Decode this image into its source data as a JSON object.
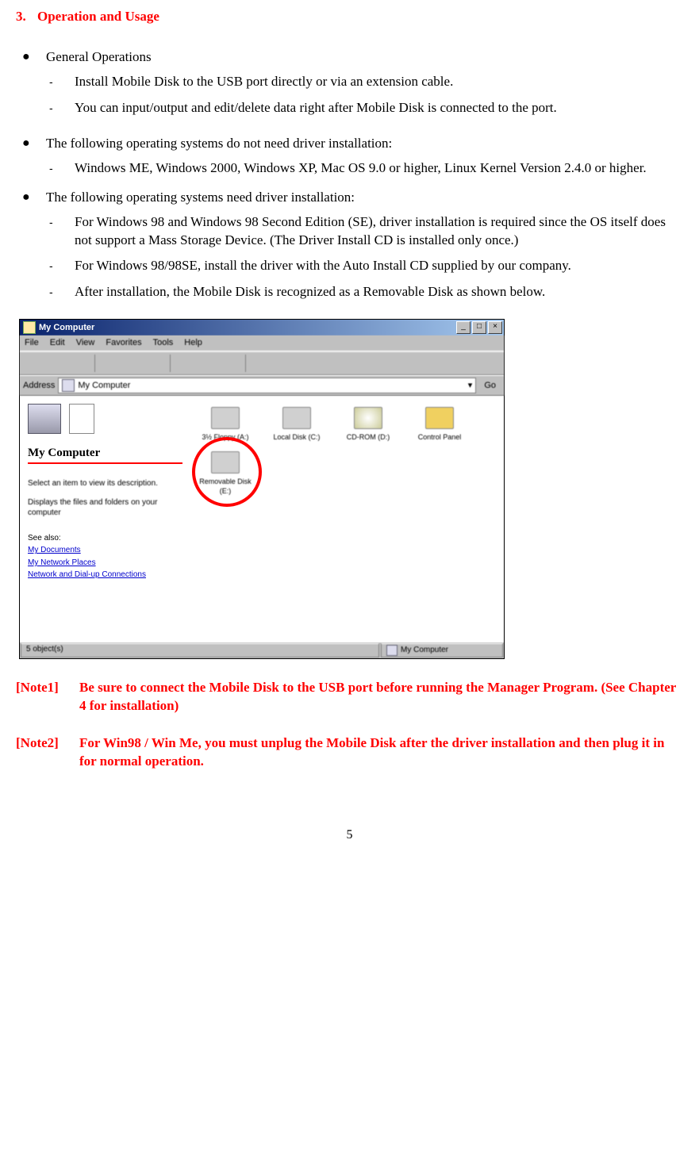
{
  "heading": {
    "number": "3.",
    "title": "Operation and Usage"
  },
  "sections": [
    {
      "bullet": "General Operations",
      "items": [
        "Install Mobile Disk to the USB port directly or via an extension cable.",
        "You can input/output and edit/delete data right after Mobile Disk is connected to the port."
      ]
    },
    {
      "bullet": "The following operating systems do not need driver installation:",
      "items": [
        "Windows ME, Windows 2000, Windows XP, Mac OS 9.0 or higher, Linux Kernel Version 2.4.0 or higher."
      ]
    },
    {
      "bullet": "The following operating systems need driver installation:",
      "items": [
        "For Windows 98 and Windows 98 Second Edition (SE), driver installation is required since the OS itself does not support a Mass Storage Device. (The Driver Install CD is installed only once.)",
        "For Windows 98/98SE, install the driver with the Auto Install CD supplied by our company.",
        "After installation, the Mobile Disk is recognized as a Removable Disk as shown below."
      ]
    }
  ],
  "screenshot": {
    "title": "My Computer",
    "menu": [
      "File",
      "Edit",
      "View",
      "Favorites",
      "Tools",
      "Help"
    ],
    "address_label": "Address",
    "address_value": "My Computer",
    "go_label": "Go",
    "left_panel": {
      "title": "My Computer",
      "desc1": "Select an item to view its description.",
      "desc2": "Displays the files and folders on your computer",
      "see_also": "See also:",
      "links": [
        "My Documents",
        "My Network Places",
        "Network and Dial-up Connections"
      ]
    },
    "drives_row1": [
      "3½ Floppy (A:)",
      "Local Disk (C:)",
      "CD-ROM (D:)",
      "Control Panel"
    ],
    "drives_row2": [
      "Removable Disk (E:)"
    ],
    "status_left": "5 object(s)",
    "status_right": "My Computer"
  },
  "notes": [
    {
      "label": "[Note1]",
      "text": "Be sure to connect the Mobile Disk to the USB port before running the Manager Program. (See Chapter 4 for installation)"
    },
    {
      "label": "[Note2]",
      "text": "For Win98 / Win Me, you must unplug the Mobile Disk after the driver installation and then plug it in for normal operation."
    }
  ],
  "page_number": "5"
}
